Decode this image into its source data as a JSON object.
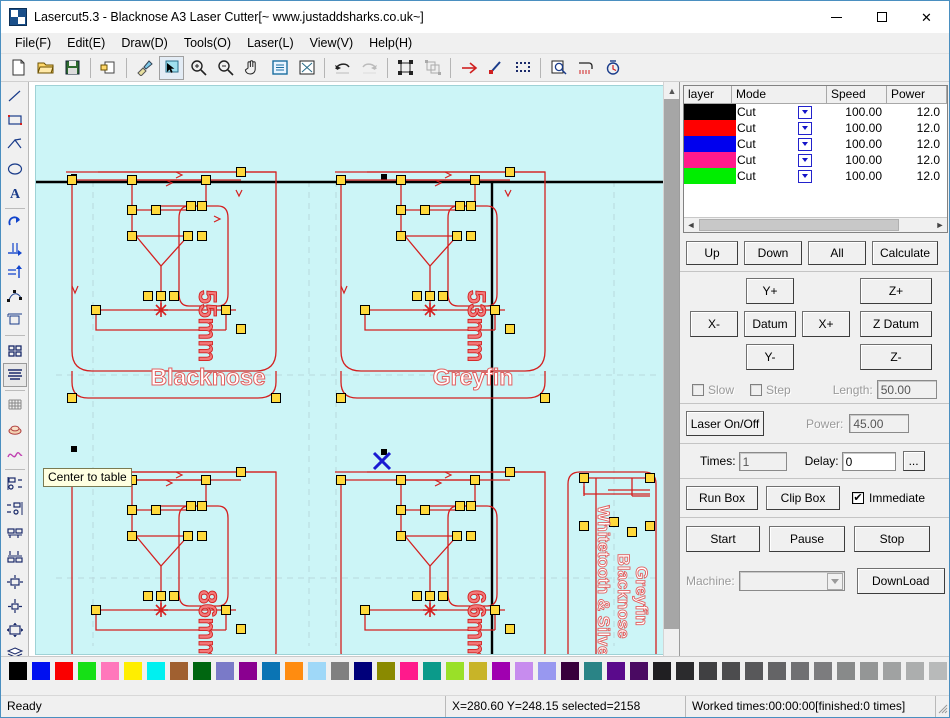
{
  "window": {
    "title": "Lasercut5.3 - Blacknose A3 Laser Cutter[~ www.justaddsharks.co.uk~]",
    "minimize": "minimize-icon",
    "maximize": "maximize-icon",
    "close": "close-icon"
  },
  "menu": {
    "items": [
      {
        "label": "File(F)"
      },
      {
        "label": "Edit(E)"
      },
      {
        "label": "Draw(D)"
      },
      {
        "label": "Tools(O)"
      },
      {
        "label": "Laser(L)"
      },
      {
        "label": "View(V)"
      },
      {
        "label": "Help(H)"
      }
    ]
  },
  "toolbar": {
    "items": [
      {
        "name": "new-file-icon"
      },
      {
        "name": "open-file-icon"
      },
      {
        "name": "save-file-icon"
      },
      {
        "name": "sep"
      },
      {
        "name": "import-icon"
      },
      {
        "name": "sep"
      },
      {
        "name": "format-brush-icon"
      },
      {
        "name": "select-region-icon"
      },
      {
        "name": "zoom-in-icon"
      },
      {
        "name": "zoom-out-icon"
      },
      {
        "name": "pan-hand-icon"
      },
      {
        "name": "zoom-page-icon"
      },
      {
        "name": "zoom-fit-icon"
      },
      {
        "name": "sep"
      },
      {
        "name": "undo-icon"
      },
      {
        "name": "redo-icon"
      },
      {
        "name": "sep"
      },
      {
        "name": "group-icon"
      },
      {
        "name": "ungroup-icon"
      },
      {
        "name": "sep"
      },
      {
        "name": "arrow-right-icon"
      },
      {
        "name": "node-edit-icon"
      },
      {
        "name": "dashed-box-icon"
      },
      {
        "name": "sep"
      },
      {
        "name": "preview-icon"
      },
      {
        "name": "cut-path-icon"
      },
      {
        "name": "estimate-time-icon"
      }
    ]
  },
  "lefttools": {
    "items": [
      {
        "name": "line-tool-icon"
      },
      {
        "name": "rectangle-tool-icon"
      },
      {
        "name": "polyline-tool-icon"
      },
      {
        "name": "ellipse-tool-icon"
      },
      {
        "name": "text-tool-icon"
      },
      {
        "name": "sep"
      },
      {
        "name": "rotate-tool-icon"
      },
      {
        "name": "mirror-horizontal-icon"
      },
      {
        "name": "mirror-vertical-icon"
      },
      {
        "name": "node-edit-tool-icon"
      },
      {
        "name": "offset-tool-icon"
      },
      {
        "name": "sep"
      },
      {
        "name": "array-copy-icon"
      },
      {
        "name": "align-text-icon"
      },
      {
        "name": "sep"
      },
      {
        "name": "grid-icon"
      },
      {
        "name": "nest-parts-icon"
      },
      {
        "name": "bezier-curve-icon"
      },
      {
        "name": "sep"
      },
      {
        "name": "align-left-icon"
      },
      {
        "name": "align-right-icon"
      },
      {
        "name": "align-top-icon"
      },
      {
        "name": "align-bottom-icon"
      },
      {
        "name": "align-center-vertical-icon"
      },
      {
        "name": "align-center-horizontal-icon"
      },
      {
        "name": "center-to-table-icon"
      },
      {
        "name": "layers-icon"
      }
    ]
  },
  "tooltip": {
    "text": "Center to table"
  },
  "canvas": {
    "background_color": "#ccf5f7",
    "path_color": "#d42020",
    "node_color": "#ffd93b",
    "axis_color": "#000000",
    "marker_color": "#1a1ad2",
    "parts": [
      {
        "name": "Blacknose",
        "dimension": "55mm"
      },
      {
        "name": "Greyfin",
        "dimension": "53mm"
      },
      {
        "name": "Whitetooth",
        "dimension": "86mm"
      },
      {
        "name": "Silvertail",
        "dimension": "66mm"
      }
    ],
    "sidebar_labels": [
      "Greyfin",
      "Blacknose",
      "Whitetooth & Silvertail"
    ]
  },
  "layer_table": {
    "headers": [
      "layer",
      "Mode",
      "Speed",
      "Power"
    ],
    "rows": [
      {
        "color": "#000000",
        "mode": "Cut",
        "speed": "100.00",
        "power": "12.0"
      },
      {
        "color": "#ff0000",
        "mode": "Cut",
        "speed": "100.00",
        "power": "12.0"
      },
      {
        "color": "#0000ee",
        "mode": "Cut",
        "speed": "100.00",
        "power": "12.0"
      },
      {
        "color": "#ff1a8c",
        "mode": "Cut",
        "speed": "100.00",
        "power": "12.0"
      },
      {
        "color": "#00ee00",
        "mode": "Cut",
        "speed": "100.00",
        "power": "12.0"
      }
    ]
  },
  "layer_buttons": {
    "up": "Up",
    "down": "Down",
    "all": "All",
    "calculate": "Calculate"
  },
  "jog": {
    "y_plus": "Y+",
    "y_minus": "Y-",
    "x_plus": "X+",
    "x_minus": "X-",
    "datum": "Datum",
    "z_plus": "Z+",
    "z_minus": "Z-",
    "z_datum": "Z Datum",
    "slow_label": "Slow",
    "slow_checked": false,
    "step_label": "Step",
    "step_checked": false,
    "length_label": "Length:",
    "length_value": "50.00"
  },
  "laser": {
    "on_off": "Laser On/Off",
    "power_label": "Power:",
    "power_value": "45.00"
  },
  "times": {
    "times_label": "Times:",
    "times_value": "1",
    "delay_label": "Delay:",
    "delay_value": "0",
    "more_label": "..."
  },
  "boxrow": {
    "run_box": "Run Box",
    "clip_box": "Clip Box",
    "immediate_label": "Immediate",
    "immediate_checked": true,
    "immediate_tick": "✔"
  },
  "runrow": {
    "start": "Start",
    "pause": "Pause",
    "stop": "Stop"
  },
  "machinerow": {
    "machine_label": "Machine:",
    "machine_value": "",
    "download": "DownLoad"
  },
  "palette": {
    "colors": [
      "#000000",
      "#0010f0",
      "#fa0000",
      "#16e016",
      "#ff77bb",
      "#ffee00",
      "#00f0f0",
      "#a06030",
      "#006610",
      "#7a7ac8",
      "#8a0090",
      "#0a74b4",
      "#ff8c10",
      "#9fd8f8",
      "#808080",
      "#00007a",
      "#8a8a00",
      "#ff1a8c",
      "#0b9a8a",
      "#9ae028",
      "#c8b428",
      "#a000b0",
      "#c78cee",
      "#9898f0",
      "#38003c",
      "#2a8486",
      "#5a0a8c",
      "#4a0a62",
      "#201f22",
      "#2b2b2d",
      "#404042",
      "#4c4c4e",
      "#58585a",
      "#646466",
      "#707072",
      "#7c7c7e",
      "#888a8a",
      "#949696",
      "#a0a2a2",
      "#acaeae",
      "#b8baba",
      "#c4c6c6"
    ]
  },
  "statusbar": {
    "ready": "Ready",
    "coords": "X=280.60 Y=248.15 selected=2158",
    "worked": "Worked times:00:00:00[finished:0 times]"
  }
}
